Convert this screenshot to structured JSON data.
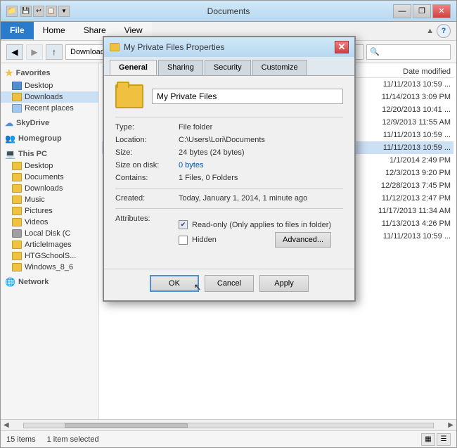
{
  "window": {
    "title": "Documents",
    "controls": {
      "minimize": "—",
      "restore": "❐",
      "close": "✕"
    }
  },
  "ribbon": {
    "tabs": [
      "File",
      "Home",
      "Share",
      "View"
    ],
    "active_tab": "File",
    "help_icon": "?"
  },
  "address_bar": {
    "back": "◀",
    "forward": "▶",
    "up": "↑",
    "path": "Downloads",
    "search_placeholder": "Search"
  },
  "sidebar": {
    "favorites_label": "Favorites",
    "favorites_icon": "★",
    "items_favorites": [
      {
        "label": "Desktop",
        "icon": "folder"
      },
      {
        "label": "Downloads",
        "icon": "folder",
        "active": true
      },
      {
        "label": "Recent places",
        "icon": "folder"
      }
    ],
    "skydrive_label": "SkyDrive",
    "homegroup_label": "Homegroup",
    "this_pc_label": "This PC",
    "items_pc": [
      {
        "label": "Desktop",
        "icon": "folder"
      },
      {
        "label": "Documents",
        "icon": "folder"
      },
      {
        "label": "Downloads",
        "icon": "folder"
      },
      {
        "label": "Music",
        "icon": "folder"
      },
      {
        "label": "Pictures",
        "icon": "folder"
      },
      {
        "label": "Videos",
        "icon": "folder"
      },
      {
        "label": "Local Disk (C",
        "icon": "disk"
      },
      {
        "label": "ArticleImages",
        "icon": "folder"
      },
      {
        "label": "HTGSchoolS...",
        "icon": "folder"
      },
      {
        "label": "Windows_8_6",
        "icon": "folder"
      }
    ],
    "network_label": "Network"
  },
  "file_list": {
    "header": "Date modified",
    "items": [
      {
        "name": "",
        "date": "11/11/2013 10:59 ..."
      },
      {
        "name": "",
        "date": "11/14/2013 3:09 PM"
      },
      {
        "name": "",
        "date": "12/20/2013 10:41 ..."
      },
      {
        "name": "",
        "date": "12/9/2013 11:55 AM"
      },
      {
        "name": "",
        "date": "11/11/2013 10:59 ..."
      },
      {
        "name": "",
        "date": "11/11/2013 10:59 ..."
      },
      {
        "name": "",
        "date": "1/1/2014 2:49 PM"
      },
      {
        "name": "",
        "date": "12/3/2013 9:20 PM"
      },
      {
        "name": "",
        "date": "12/28/2013 7:45 PM"
      },
      {
        "name": "",
        "date": "11/12/2013 2:47 PM"
      },
      {
        "name": "",
        "date": "11/17/2013 11:34 AM"
      },
      {
        "name": "",
        "date": "11/13/2013 4:26 PM"
      },
      {
        "name": "",
        "date": "11/11/2013 10:59 ..."
      }
    ]
  },
  "status_bar": {
    "count": "15 items",
    "selected": "1 item selected"
  },
  "dialog": {
    "title": "My Private Files Properties",
    "tabs": [
      "General",
      "Sharing",
      "Security",
      "Customize"
    ],
    "active_tab": "General",
    "folder_name": "My Private Files",
    "type_label": "Type:",
    "type_value": "File folder",
    "location_label": "Location:",
    "location_value": "C:\\Users\\Lori\\Documents",
    "size_label": "Size:",
    "size_value": "24 bytes (24 bytes)",
    "size_disk_label": "Size on disk:",
    "size_disk_value": "0 bytes",
    "contains_label": "Contains:",
    "contains_value": "1 Files, 0 Folders",
    "created_label": "Created:",
    "created_value": "Today, January 1, 2014, 1 minute ago",
    "attributes_label": "Attributes:",
    "readonly_label": "Read-only (Only applies to files in folder)",
    "hidden_label": "Hidden",
    "advanced_btn": "Advanced...",
    "ok_btn": "OK",
    "cancel_btn": "Cancel",
    "apply_btn": "Apply"
  }
}
